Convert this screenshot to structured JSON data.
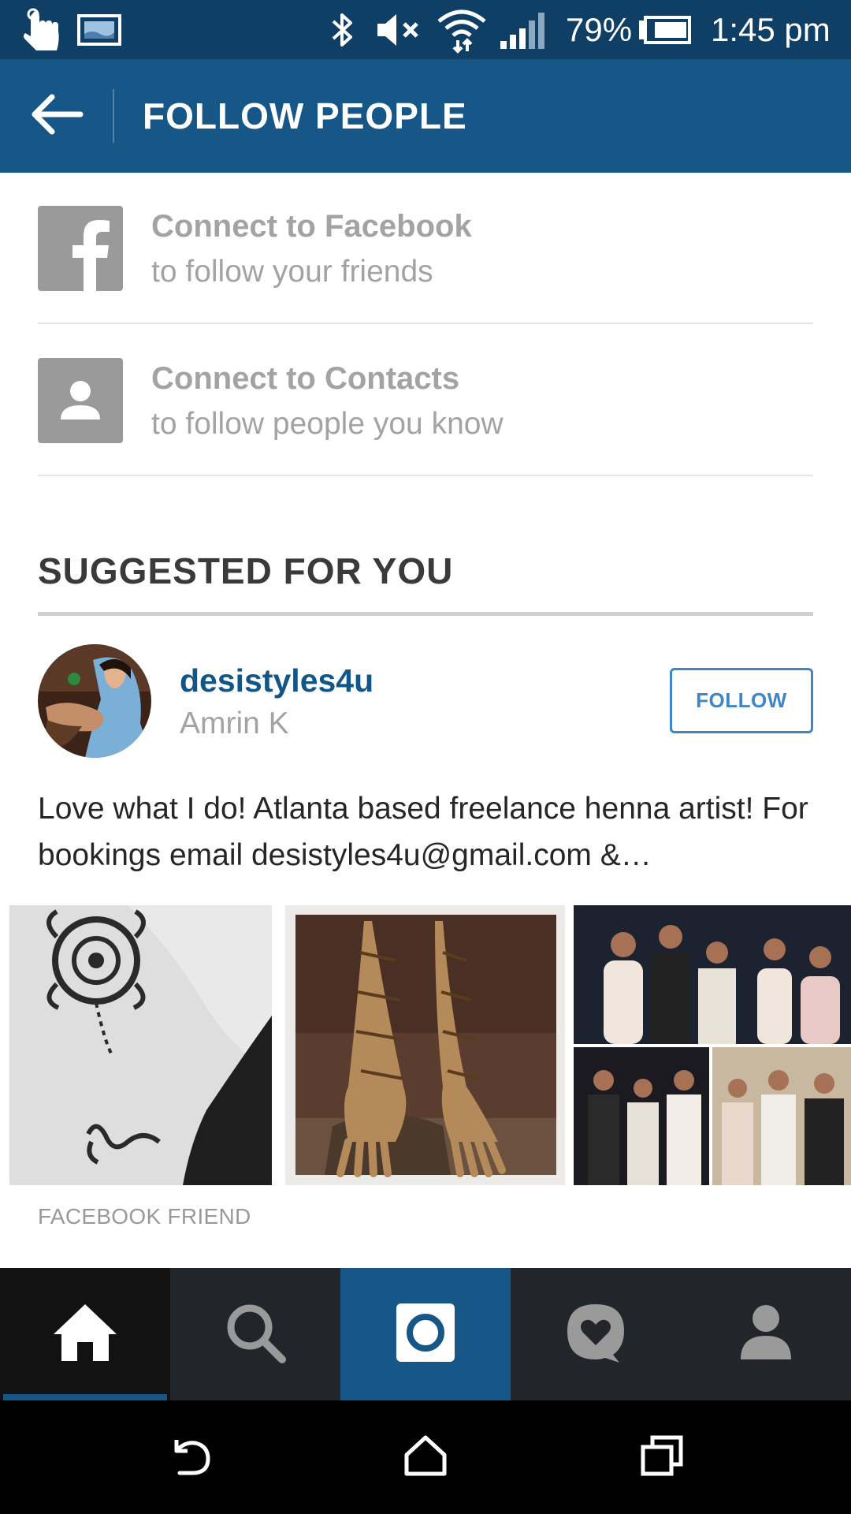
{
  "status_bar": {
    "battery": "79%",
    "time": "1:45 pm",
    "icons": [
      "touch-icon",
      "image-icon",
      "bluetooth-icon",
      "mute-icon",
      "wifi-icon",
      "signal-icon",
      "battery-icon"
    ]
  },
  "app_bar": {
    "title": "FOLLOW PEOPLE",
    "background": "#175787"
  },
  "connect": [
    {
      "icon": "facebook-icon",
      "title": "Connect to Facebook",
      "subtitle": "to follow your friends"
    },
    {
      "icon": "contacts-icon",
      "title": "Connect to Contacts",
      "subtitle": "to follow people you know"
    }
  ],
  "suggested": {
    "heading": "SUGGESTED FOR YOU",
    "user": {
      "username": "desistyles4u",
      "full_name": "Amrin K",
      "follow_label": "FOLLOW",
      "bio": "Love what I do! Atlanta based freelance henna artist! For bookings email desistyles4u@gmail.com &…",
      "source": "FACEBOOK FRIEND"
    },
    "photos": [
      "henna-wrist-photo",
      "henna-hands-photo",
      "group-collage-photo"
    ]
  },
  "tab_bar": {
    "tabs": [
      "home-icon",
      "search-icon",
      "camera-icon",
      "activity-icon",
      "profile-icon"
    ],
    "active": "home-icon",
    "accent": "#175787"
  },
  "nav_bar": {
    "buttons": [
      "back-nav-icon",
      "home-nav-icon",
      "recents-nav-icon"
    ]
  },
  "colors": {
    "status_bar": "#0f3f64",
    "username": "#125688",
    "follow_button": "#3f86c6"
  }
}
